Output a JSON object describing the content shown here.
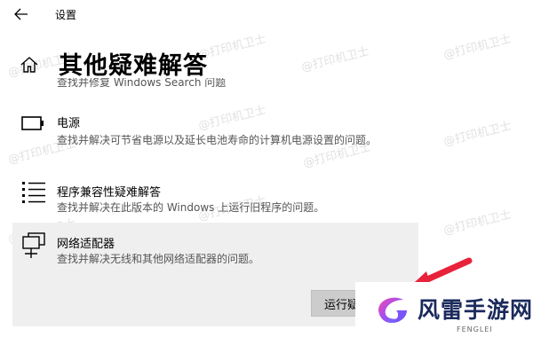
{
  "window": {
    "title": "设置"
  },
  "page": {
    "title": "其他疑难解答"
  },
  "partial_item": {
    "desc": "查找并修复 Windows Search 问题"
  },
  "items": [
    {
      "title": "电源",
      "desc": "查找并解决可节省电源以及延长电池寿命的计算机电源设置的问题。",
      "icon": "battery-icon"
    },
    {
      "title": "程序兼容性疑难解答",
      "desc": "查找并解决在此版本的 Windows 上运行旧程序的问题。",
      "icon": "list-icon"
    },
    {
      "title": "网络适配器",
      "desc": "查找并解决无线和其他网络适配器的问题。",
      "icon": "network-adapter-icon"
    }
  ],
  "run_button": {
    "label": "运行疑"
  },
  "watermark": {
    "text": "@打印机卫士"
  },
  "brand": {
    "name": "风雷手游网",
    "sub": "FENGLEI"
  },
  "colors": {
    "selected_bg": "#efefef",
    "button_bg": "#cccccc",
    "arrow": "#e8223a",
    "brand_text": "#1b2a5c"
  }
}
